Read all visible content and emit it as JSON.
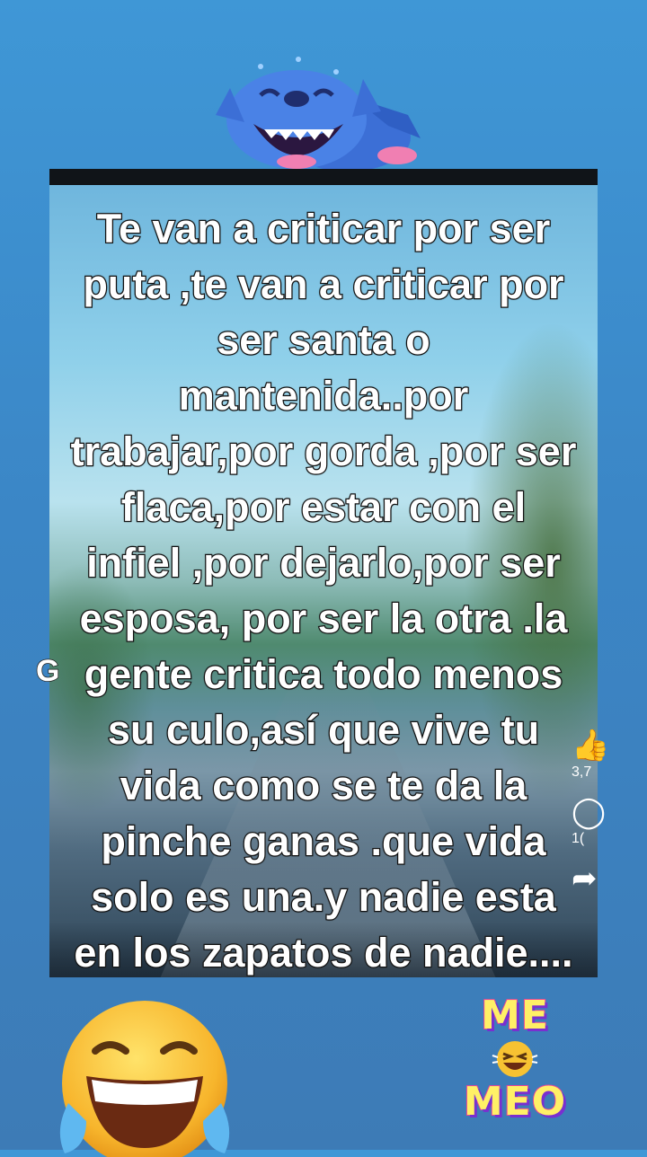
{
  "caption": {
    "lines": [
      "Te van a criticar por ser",
      "puta ,te van a criticar por",
      "ser santa o",
      "mantenida..por",
      "trabajar,por gorda ,por ser",
      "flaca,por estar con el",
      "infiel ,por dejarlo,por ser",
      "esposa, por ser la otra .la",
      "gente critica todo menos",
      "su culo,así que vive tu",
      "vida como se te da la",
      "pinche ganas .que vida",
      "solo es una.y nadie esta",
      "en los zapatos de nadie...."
    ]
  },
  "stray_letter": "G",
  "side_actions": {
    "like_icon": "thumbs-up-icon",
    "like_count": "3,7",
    "comment_icon": "comment-icon",
    "comment_count": "1(",
    "share_icon": "share-icon"
  },
  "sticker": {
    "top_word": "ME",
    "bottom_word": "MEO",
    "emoji_icon": "laughing-emoji-icon"
  },
  "big_emoji": "tears-of-joy-emoji-icon",
  "mascot": "stitch-laughing-icon"
}
